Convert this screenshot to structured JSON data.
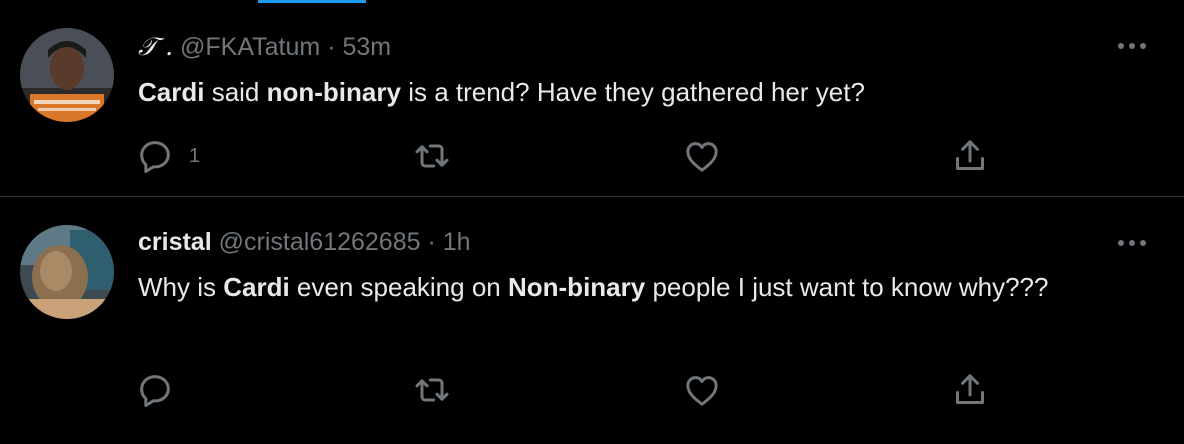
{
  "colors": {
    "background": "#000000",
    "text": "#e7e9ea",
    "muted": "#71767b",
    "divider": "#2f3336",
    "accent": "#1d9bf0"
  },
  "tweets": [
    {
      "display_name": "𝒯 .",
      "handle": "@FKATatum",
      "dot": "·",
      "time": "53m",
      "text": [
        {
          "t": "Cardi",
          "bold": true
        },
        {
          "t": " said ",
          "bold": false
        },
        {
          "t": "non-binary",
          "bold": true
        },
        {
          "t": " is a trend? Have they gathered her yet?",
          "bold": false
        }
      ],
      "reply_count": "1",
      "icons": {
        "more": "more-dots-icon",
        "reply": "reply-icon",
        "retweet": "retweet-icon",
        "like": "heart-icon",
        "share": "share-icon"
      }
    },
    {
      "display_name": "cristal",
      "handle": "@cristal61262685",
      "dot": "·",
      "time": "1h",
      "text": [
        {
          "t": "Why is ",
          "bold": false
        },
        {
          "t": "Cardi",
          "bold": true
        },
        {
          "t": " even speaking on ",
          "bold": false
        },
        {
          "t": "Non-binary",
          "bold": true
        },
        {
          "t": " people I just want to know why???",
          "bold": false
        }
      ],
      "reply_count": "",
      "icons": {
        "more": "more-dots-icon",
        "reply": "reply-icon",
        "retweet": "retweet-icon",
        "like": "heart-icon",
        "share": "share-icon"
      }
    }
  ]
}
